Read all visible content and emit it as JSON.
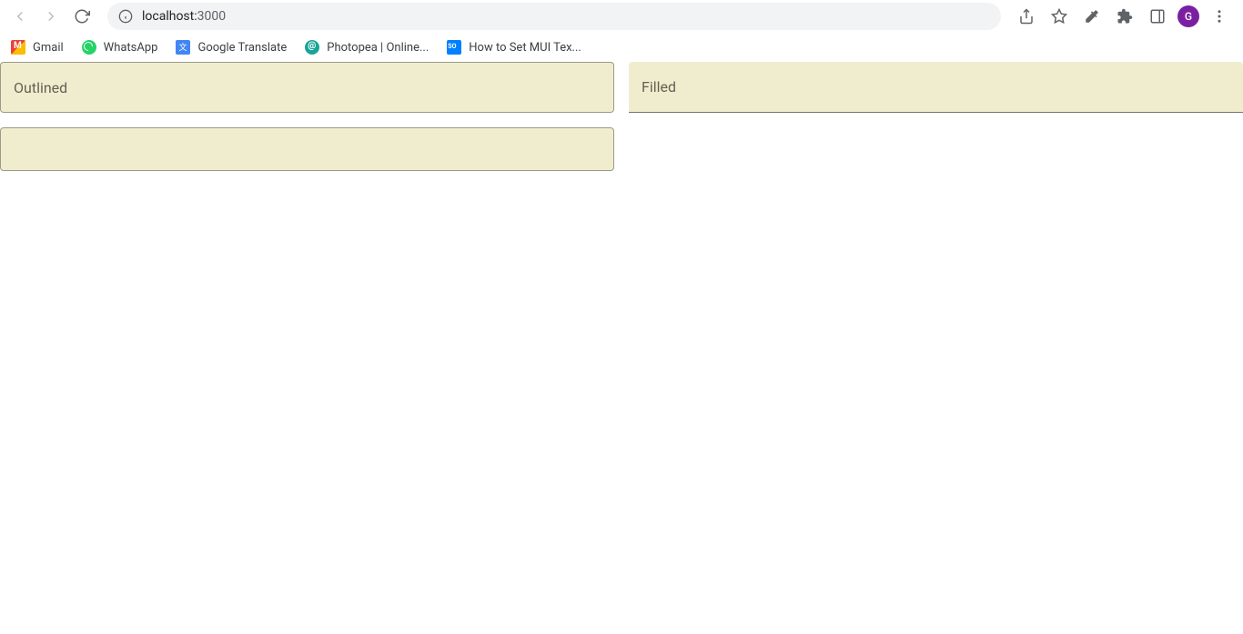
{
  "browser": {
    "url_host": "localhost:",
    "url_port": "3000",
    "avatar_letter": "G"
  },
  "bookmarks": [
    {
      "label": "Gmail",
      "iconClass": "gmail-icon"
    },
    {
      "label": "WhatsApp",
      "iconClass": "whatsapp-icon"
    },
    {
      "label": "Google Translate",
      "iconClass": "gtranslate-icon"
    },
    {
      "label": "Photopea | Online...",
      "iconClass": "photopea-icon"
    },
    {
      "label": "How to Set MUI Tex...",
      "iconClass": "mui-icon"
    }
  ],
  "fields": {
    "outlined_label": "Outlined",
    "filled_label": "Filled"
  },
  "colors": {
    "field_bg": "#f0edcf",
    "avatar_bg": "#7b1fa2"
  }
}
